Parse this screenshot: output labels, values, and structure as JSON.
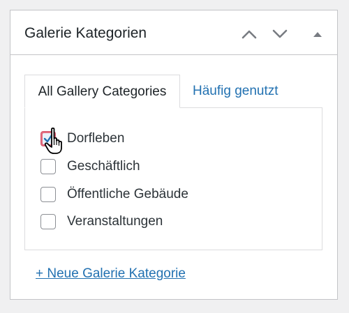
{
  "metabox": {
    "title": "Galerie Kategorien",
    "controls": {
      "move_up_icon": "chevron-up-icon",
      "move_down_icon": "chevron-down-icon",
      "toggle_icon": "triangle-up-icon"
    }
  },
  "tabs": [
    {
      "label": "All Gallery Categories",
      "active": true
    },
    {
      "label": "Häufig genutzt",
      "active": false
    }
  ],
  "categories": [
    {
      "label": "Dorfleben",
      "checked": true
    },
    {
      "label": "Geschäftlich",
      "checked": false
    },
    {
      "label": "Öffentliche Gebäude",
      "checked": false
    },
    {
      "label": "Veranstaltungen",
      "checked": false
    }
  ],
  "add_link": "+ Neue Galerie Kategorie",
  "colors": {
    "link": "#2271b1",
    "text": "#1d2327",
    "border": "#c3c4c7",
    "checked_highlight": "#e26d80",
    "icon": "#787c82"
  }
}
